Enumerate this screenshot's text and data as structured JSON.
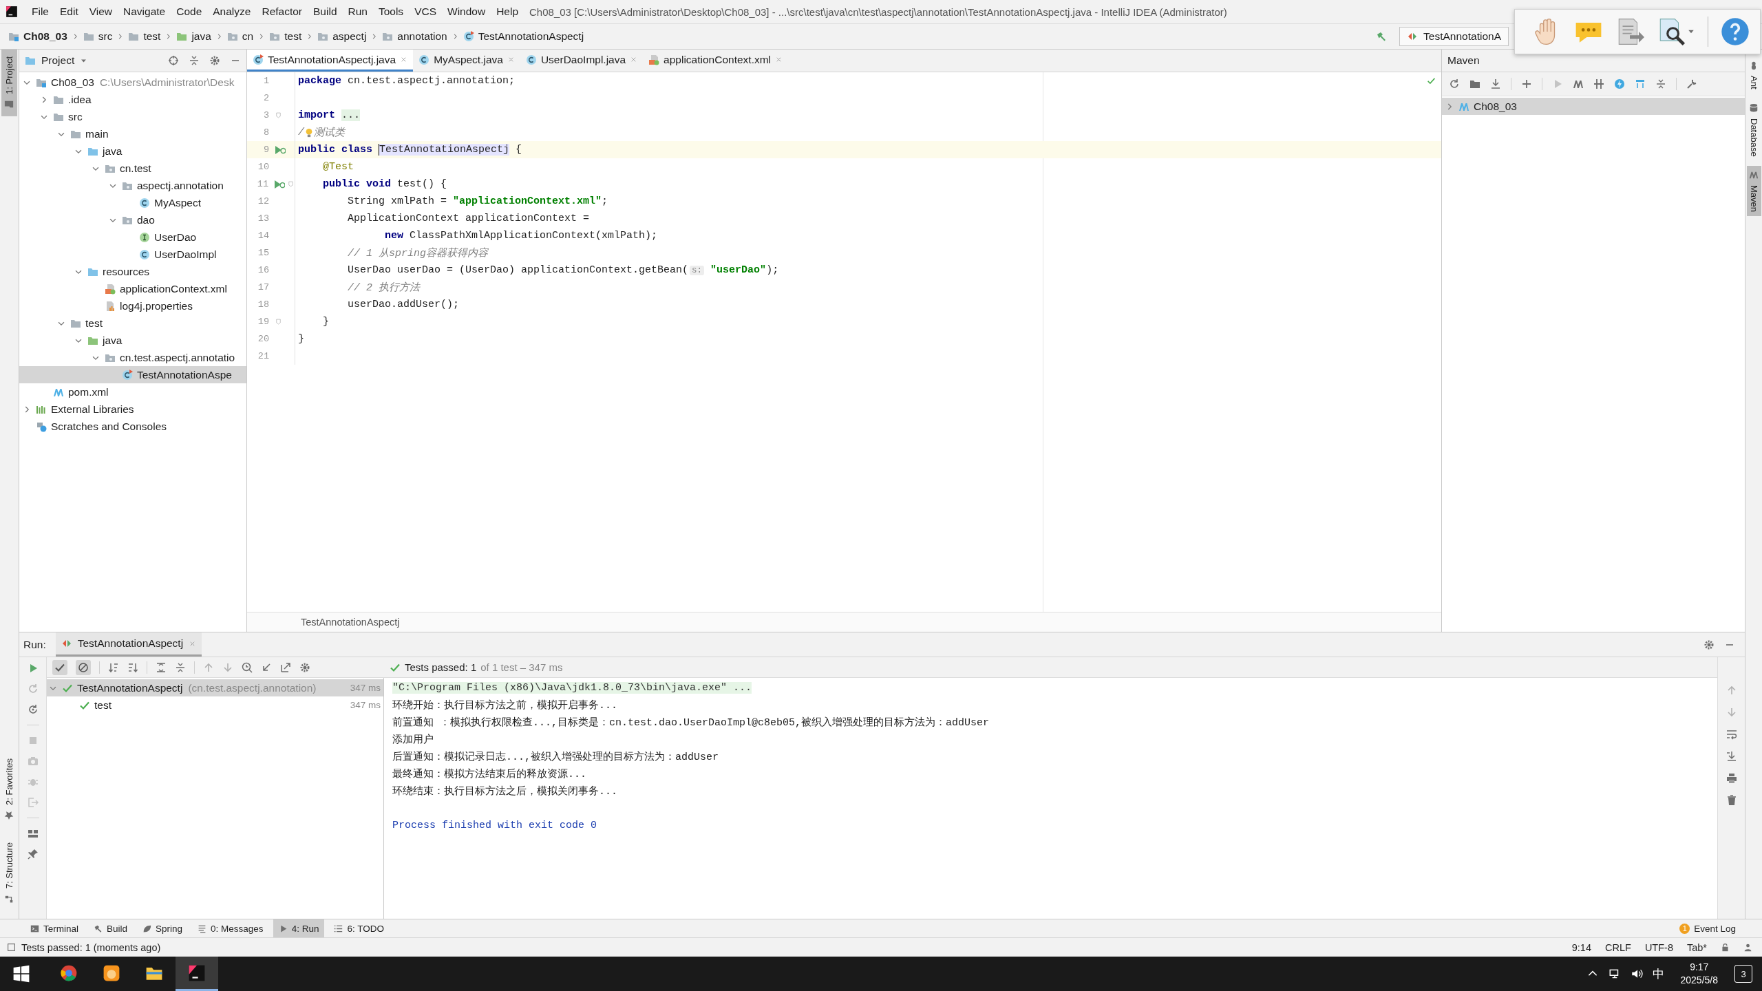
{
  "menu_bar": {
    "items": [
      "File",
      "Edit",
      "View",
      "Navigate",
      "Code",
      "Analyze",
      "Refactor",
      "Build",
      "Run",
      "Tools",
      "VCS",
      "Window",
      "Help"
    ],
    "title": "Ch08_03 [C:\\Users\\Administrator\\Desktop\\Ch08_03] - ...\\src\\test\\java\\cn\\test\\aspectj\\annotation\\TestAnnotationAspectj.java - IntelliJ IDEA (Administrator)"
  },
  "navigation_bar": {
    "path": [
      {
        "label": "Ch08_03",
        "kind": "module"
      },
      {
        "label": "src",
        "kind": "folder"
      },
      {
        "label": "test",
        "kind": "folder"
      },
      {
        "label": "java",
        "kind": "test-root"
      },
      {
        "label": "cn",
        "kind": "package"
      },
      {
        "label": "test",
        "kind": "package"
      },
      {
        "label": "aspectj",
        "kind": "package"
      },
      {
        "label": "annotation",
        "kind": "package"
      },
      {
        "label": "TestAnnotationAspectj",
        "kind": "test-class"
      }
    ],
    "run_configuration": "TestAnnotationA"
  },
  "left_tool_strip": {
    "top": [
      {
        "label": "1: Project",
        "selected": true
      }
    ],
    "bottom": [
      {
        "label": "2: Favorites",
        "selected": false
      },
      {
        "label": "7: Structure",
        "selected": false
      }
    ]
  },
  "right_tool_strip": [
    {
      "label": "Ant",
      "selected": false
    },
    {
      "label": "Database",
      "selected": false
    },
    {
      "label": "Maven",
      "selected": true
    }
  ],
  "project_panel": {
    "title": "Project",
    "tree": [
      {
        "label": "Ch08_03",
        "hint": "C:\\Users\\Administrator\\Desk",
        "kind": "module",
        "expanded": true,
        "selected": false,
        "children": [
          {
            "label": ".idea",
            "kind": "folder",
            "expanded": false,
            "selected": false
          },
          {
            "label": "src",
            "kind": "folder",
            "expanded": true,
            "selected": false,
            "children": [
              {
                "label": "main",
                "kind": "folder",
                "expanded": true,
                "selected": false,
                "children": [
                  {
                    "label": "java",
                    "kind": "source-root",
                    "expanded": true,
                    "selected": false,
                    "children": [
                      {
                        "label": "cn.test",
                        "kind": "package",
                        "expanded": true,
                        "selected": false,
                        "children": [
                          {
                            "label": "aspectj.annotation",
                            "kind": "package",
                            "expanded": true,
                            "selected": false,
                            "children": [
                              {
                                "label": "MyAspect",
                                "kind": "class",
                                "selected": false
                              }
                            ]
                          },
                          {
                            "label": "dao",
                            "kind": "package",
                            "expanded": true,
                            "selected": false,
                            "children": [
                              {
                                "label": "UserDao",
                                "kind": "interface",
                                "selected": false
                              },
                              {
                                "label": "UserDaoImpl",
                                "kind": "class",
                                "selected": false
                              }
                            ]
                          }
                        ]
                      }
                    ]
                  },
                  {
                    "label": "resources",
                    "kind": "source-root",
                    "expanded": true,
                    "selected": false,
                    "children": [
                      {
                        "label": "applicationContext.xml",
                        "kind": "xml",
                        "selected": false
                      },
                      {
                        "label": "log4j.properties",
                        "kind": "properties",
                        "selected": false
                      }
                    ]
                  }
                ]
              },
              {
                "label": "test",
                "kind": "folder",
                "expanded": true,
                "selected": false,
                "children": [
                  {
                    "label": "java",
                    "kind": "test-root",
                    "expanded": true,
                    "selected": false,
                    "children": [
                      {
                        "label": "cn.test.aspectj.annotatio",
                        "kind": "package",
                        "expanded": true,
                        "selected": false,
                        "children": [
                          {
                            "label": "TestAnnotationAspe",
                            "kind": "test-class",
                            "selected": true
                          }
                        ]
                      }
                    ]
                  }
                ]
              }
            ]
          },
          {
            "label": "pom.xml",
            "kind": "maven",
            "selected": false
          }
        ]
      },
      {
        "label": "External Libraries",
        "kind": "libraries",
        "expanded": false,
        "selected": false
      },
      {
        "label": "Scratches and Consoles",
        "kind": "scratches",
        "selected": false
      }
    ]
  },
  "editor": {
    "tabs": [
      {
        "label": "TestAnnotationAspectj.java",
        "kind": "test-class",
        "selected": true
      },
      {
        "label": "MyAspect.java",
        "kind": "class",
        "selected": false
      },
      {
        "label": "UserDaoImpl.java",
        "kind": "class",
        "selected": false
      },
      {
        "label": "applicationContext.xml",
        "kind": "xml",
        "selected": false
      }
    ],
    "lines": [
      {
        "number": "1",
        "current": false,
        "code": [
          {
            "kind": "keyword",
            "text": "package "
          },
          {
            "kind": "plain",
            "text": "cn.test.aspectj.annotation;"
          }
        ]
      },
      {
        "number": "2",
        "current": false
      },
      {
        "number": "3",
        "current": false,
        "gutter": [
          {
            "kind": "fold"
          }
        ],
        "code": [
          {
            "kind": "keyword",
            "text": "import "
          },
          {
            "kind": "folded",
            "text": "..."
          }
        ]
      },
      {
        "number": "8",
        "current": false,
        "code": [
          {
            "kind": "comment",
            "text": "/"
          },
          {
            "kind": "bulb"
          },
          {
            "kind": "comment",
            "text": "测试类"
          }
        ]
      },
      {
        "number": "9",
        "current": true,
        "gutter": [
          {
            "kind": "run"
          }
        ],
        "code": [
          {
            "kind": "keyword",
            "text": "public class "
          },
          {
            "kind": "caret"
          },
          {
            "kind": "usage",
            "text": "TestAnnotationAspectj"
          },
          {
            "kind": "plain",
            "text": " {"
          }
        ]
      },
      {
        "number": "10",
        "current": false,
        "code": [
          {
            "kind": "annotation",
            "text": "    @Test"
          }
        ]
      },
      {
        "number": "11",
        "current": false,
        "gutter": [
          {
            "kind": "run"
          },
          {
            "kind": "fold"
          }
        ],
        "code": [
          {
            "kind": "keyword",
            "text": "    public void "
          },
          {
            "kind": "plain",
            "text": "test() {"
          }
        ]
      },
      {
        "number": "12",
        "current": false,
        "code": [
          {
            "kind": "plain",
            "text": "        String xmlPath = "
          },
          {
            "kind": "string",
            "text": "\"applicationContext.xml\""
          },
          {
            "kind": "plain",
            "text": ";"
          }
        ]
      },
      {
        "number": "13",
        "current": false,
        "code": [
          {
            "kind": "plain",
            "text": "        ApplicationContext applicationContext ="
          }
        ]
      },
      {
        "number": "14",
        "current": false,
        "code": [
          {
            "kind": "keyword",
            "text": "              new "
          },
          {
            "kind": "plain",
            "text": "ClassPathXmlApplicationContext(xmlPath);"
          }
        ]
      },
      {
        "number": "15",
        "current": false,
        "code": [
          {
            "kind": "comment",
            "text": "        // 1 从spring容器获得内容"
          }
        ]
      },
      {
        "number": "16",
        "current": false,
        "code": [
          {
            "kind": "plain",
            "text": "        UserDao userDao = (UserDao) applicationContext.getBean("
          },
          {
            "kind": "hint",
            "text": "s:"
          },
          {
            "kind": "string",
            "text": " \"userDao\""
          },
          {
            "kind": "plain",
            "text": ");"
          }
        ]
      },
      {
        "number": "17",
        "current": false,
        "code": [
          {
            "kind": "comment",
            "text": "        // 2 执行方法"
          }
        ]
      },
      {
        "number": "18",
        "current": false,
        "code": [
          {
            "kind": "plain",
            "text": "        userDao.addUser();"
          }
        ]
      },
      {
        "number": "19",
        "current": false,
        "gutter": [
          {
            "kind": "fold"
          }
        ],
        "code": [
          {
            "kind": "plain",
            "text": "    }"
          }
        ]
      },
      {
        "number": "20",
        "current": false,
        "code": [
          {
            "kind": "plain",
            "text": "}"
          }
        ]
      },
      {
        "number": "21",
        "current": false
      }
    ],
    "footer": "TestAnnotationAspectj"
  },
  "maven_panel": {
    "title": "Maven",
    "tree": [
      {
        "label": "Ch08_03",
        "kind": "maven",
        "expanded": false,
        "selected": true
      }
    ]
  },
  "run_panel": {
    "title": "Run:",
    "tab": "TestAnnotationAspectj",
    "summary": "Tests passed: 1",
    "summary_detail": "of 1 test – 347 ms",
    "tests": [
      {
        "label": "TestAnnotationAspectj",
        "hint": "(cn.test.aspectj.annotation)",
        "time": "347 ms",
        "kind": "passed",
        "expanded": true,
        "selected": true,
        "children": [
          {
            "label": "test",
            "time": "347 ms",
            "kind": "passed",
            "selected": false
          }
        ]
      }
    ],
    "console": [
      {
        "kind": "command",
        "text": "\"C:\\Program Files (x86)\\Java\\jdk1.8.0_73\\bin\\java.exe\" ..."
      },
      {
        "kind": "output",
        "text": "环绕开始：执行目标方法之前，模拟开启事务..."
      },
      {
        "kind": "output",
        "text": "前置通知 ：模拟执行权限检查...,目标类是：cn.test.dao.UserDaoImpl@c8eb05,被织入增强处理的目标方法为：addUser"
      },
      {
        "kind": "output",
        "text": "添加用户"
      },
      {
        "kind": "output",
        "text": "后置通知：模拟记录日志...,被织入增强处理的目标方法为：addUser"
      },
      {
        "kind": "output",
        "text": "最终通知：模拟方法结束后的释放资源..."
      },
      {
        "kind": "output",
        "text": "环绕结束：执行目标方法之后，模拟关闭事务..."
      },
      {
        "kind": "exit",
        "text": "Process finished with exit code 0"
      }
    ]
  },
  "tool_window_bar": {
    "tabs": [
      {
        "label": "Terminal",
        "kind": "terminal",
        "selected": false
      },
      {
        "label": "Build",
        "kind": "build",
        "selected": false
      },
      {
        "label": "Spring",
        "kind": "spring",
        "selected": false
      },
      {
        "label": "0: Messages",
        "kind": "messages",
        "selected": false
      },
      {
        "label": "4: Run",
        "kind": "run",
        "selected": true
      },
      {
        "label": "6: TODO",
        "kind": "todo",
        "selected": false
      }
    ],
    "event_log": {
      "label": "Event Log",
      "badge": "1"
    }
  },
  "status_bar": {
    "message": "Tests passed: 1 (moments ago)",
    "items": [
      "9:14",
      "CRLF",
      "UTF-8",
      "Tab*"
    ]
  },
  "taskbar": {
    "apps": [
      {
        "kind": "browser",
        "selected": false
      },
      {
        "kind": "app",
        "selected": false
      },
      {
        "kind": "explorer",
        "selected": false
      },
      {
        "kind": "ide",
        "selected": true
      }
    ],
    "input_method": "中",
    "time": "9:17",
    "date": "2025/5/8",
    "notifications": "3"
  }
}
